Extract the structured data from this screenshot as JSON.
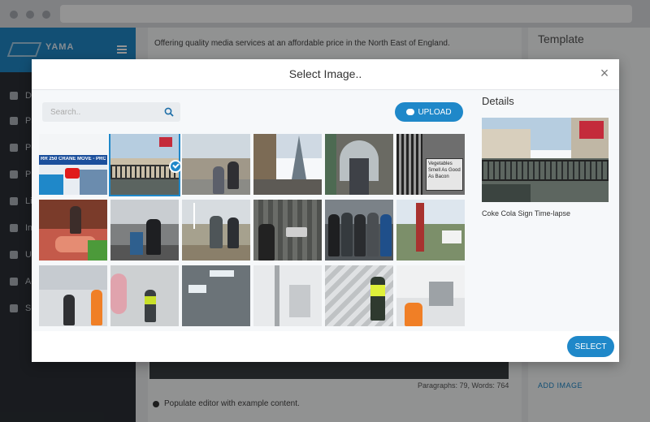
{
  "background": {
    "brand_text": "YAMA",
    "sidebar_items": [
      "Da",
      "Pa",
      "Po",
      "Pr",
      "Li",
      "Im",
      "Us",
      "Ac",
      "Se"
    ],
    "intro_text": "Offering quality media services at an affordable price in the North East of England.",
    "template_label": "Template",
    "paragraph_count": "Paragraphs: 79, Words: 764",
    "populate_text": "Populate editor with example content.",
    "add_image_link": "ADD IMAGE"
  },
  "modal": {
    "title": "Select Image..",
    "close_icon": "close-icon",
    "search_placeholder": "Search..",
    "upload_label": "UPLOAD",
    "select_label": "SELECT",
    "details": {
      "heading": "Details",
      "caption": "Coke Cola Sign Time-lapse"
    },
    "thumbnails": [
      {
        "name": "thumb-crane-move-video",
        "selected": false,
        "overlay": "RR 250 CRANE MOVE - PRO"
      },
      {
        "name": "thumb-coke-cola-sign",
        "selected": true
      },
      {
        "name": "thumb-street-crowd",
        "selected": false
      },
      {
        "name": "thumb-shard-building",
        "selected": false
      },
      {
        "name": "thumb-market-arch",
        "selected": false
      },
      {
        "name": "thumb-vegetable-shop",
        "selected": false,
        "overlay": "Vegetables Smell As Good As Bacon"
      },
      {
        "name": "thumb-fish-market",
        "selected": false
      },
      {
        "name": "thumb-camera-crew",
        "selected": false
      },
      {
        "name": "thumb-wind-turbine-walk",
        "selected": false
      },
      {
        "name": "thumb-man-at-wall",
        "selected": false
      },
      {
        "name": "thumb-group-photo",
        "selected": false
      },
      {
        "name": "thumb-bird-feeder",
        "selected": false
      },
      {
        "name": "thumb-warehouse-workers",
        "selected": false
      },
      {
        "name": "thumb-site-worker",
        "selected": false
      },
      {
        "name": "thumb-ceiling-lights",
        "selected": false
      },
      {
        "name": "thumb-white-corridor",
        "selected": false
      },
      {
        "name": "thumb-scaffold-worker",
        "selected": false
      },
      {
        "name": "thumb-hall-workers",
        "selected": false
      }
    ]
  },
  "colors": {
    "accent": "#1f88c9",
    "sidebar": "#2b3036"
  }
}
